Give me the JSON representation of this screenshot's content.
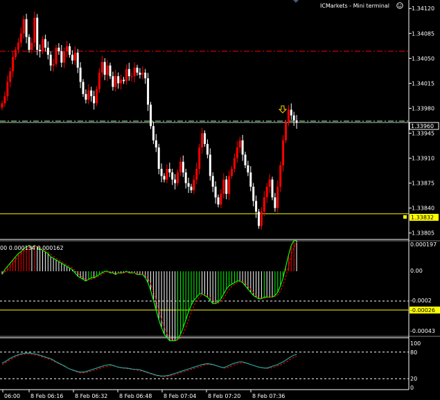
{
  "window": {
    "title": "ICMarkets - Mini terminal",
    "title_icon": "smiley-icon"
  },
  "colors": {
    "background": "#000000",
    "axis": "#ffffff",
    "bull_candle": "#ff0000",
    "bear_candle": "#ffffff",
    "level_line": "#ffff00",
    "resistance_line": "#ff0000",
    "bid_line": "#98fb98",
    "macd_up": "#ff0000",
    "macd_down": "#ffffff",
    "macd_green": "#00ff00",
    "stoch_main": "#20b2aa",
    "stoch_signal": "#ff0000",
    "arrow": "#ffd700"
  },
  "price_panel": {
    "axis_labels": [
      "1.34120",
      "1.34085",
      "1.34050",
      "1.34015",
      "1.33980",
      "1.33945",
      "1.33910",
      "1.33875",
      "1.33840",
      "1.33805"
    ],
    "current_price_label": "1.33960",
    "level_label": "1.33832",
    "arrow_icon": "down-arrow-icon"
  },
  "macd_panel": {
    "header": "00 0.000134 0.000162",
    "axis_labels": [
      "0.000197",
      "0.00",
      "-0.0002",
      "-0.00043"
    ],
    "level_label": "-0.00026"
  },
  "stoch_panel": {
    "axis_labels": [
      "100",
      "80",
      "20",
      "0"
    ]
  },
  "time_axis": {
    "labels": [
      "06:00",
      "8 Feb 06:16",
      "8 Feb 06:32",
      "8 Feb 06:48",
      "8 Feb 07:04",
      "8 Feb 07:20",
      "8 Feb 07:36"
    ]
  },
  "chart_data": {
    "type": "candlestick",
    "symbol": "",
    "price_range": [
      1.33796,
      1.34128
    ],
    "current_price": 1.3396,
    "horizontal_levels": {
      "resistance": 1.3406,
      "bid": 1.33962,
      "support": 1.33832
    },
    "closes": [
      1.33987,
      1.33997,
      1.34017,
      1.34032,
      1.34052,
      1.34062,
      1.34072,
      1.34085,
      1.34105,
      1.3408,
      1.34062,
      1.34072,
      1.34107,
      1.34062,
      1.3406,
      1.34077,
      1.34065,
      1.34055,
      1.3404,
      1.34042,
      1.34065,
      1.3406,
      1.34044,
      1.3406,
      1.34067,
      1.34055,
      1.34047,
      1.34058,
      1.34037,
      1.34017,
      1.34,
      1.33992,
      1.34005,
      1.33997,
      1.33987,
      1.34007,
      1.3403,
      1.34045,
      1.34027,
      1.3404,
      1.34025,
      1.3401,
      1.34025,
      1.34015,
      1.3402,
      1.34018,
      1.34035,
      1.34025,
      1.34025,
      1.34037,
      1.3403,
      1.34027,
      1.3403,
      1.34022,
      1.33985,
      1.33955,
      1.33935,
      1.33925,
      1.33895,
      1.33885,
      1.3388,
      1.33895,
      1.3389,
      1.3388,
      1.33875,
      1.3389,
      1.33905,
      1.3389,
      1.33875,
      1.3387,
      1.33865,
      1.3388,
      1.33895,
      1.33925,
      1.33945,
      1.3393,
      1.33915,
      1.33885,
      1.3387,
      1.33855,
      1.33845,
      1.3386,
      1.3388,
      1.3386,
      1.33885,
      1.33895,
      1.3391,
      1.33925,
      1.33935,
      1.33915,
      1.339,
      1.3389,
      1.3387,
      1.3385,
      1.33835,
      1.33815,
      1.33835,
      1.33855,
      1.3387,
      1.3388,
      1.33855,
      1.3384,
      1.3387,
      1.339,
      1.33935,
      1.3396,
      1.33978,
      1.3397,
      1.33963,
      1.3396
    ],
    "macd": {
      "histogram": [
        -2e-05,
        1e-05,
        3e-05,
        5e-05,
        7e-05,
        9e-05,
        0.00011,
        0.00012,
        0.00014,
        0.00015,
        0.00016,
        0.00015,
        0.00016,
        0.00015,
        0.00014,
        0.00013,
        0.00012,
        0.00011,
        9e-05,
        8e-05,
        7e-05,
        6e-05,
        5e-05,
        4e-05,
        3e-05,
        2e-05,
        1e-05,
        -1e-05,
        -3e-05,
        -4e-05,
        -5e-05,
        -6e-05,
        -5e-05,
        -4e-05,
        -4e-05,
        -3e-05,
        -2e-05,
        -1e-05,
        0.0,
        0.0,
        -1e-05,
        -1e-05,
        -2e-05,
        -1e-05,
        -1e-05,
        -1e-05,
        0.0,
        -1e-05,
        -1e-05,
        -1e-05,
        -2e-05,
        -2e-05,
        -2e-05,
        -4e-05,
        -7e-05,
        -0.00012,
        -0.00018,
        -0.00024,
        -0.0003,
        -0.00035,
        -0.00039,
        -0.00041,
        -0.00043,
        -0.00043,
        -0.00043,
        -0.00042,
        -0.00039,
        -0.00035,
        -0.0003,
        -0.00025,
        -0.00021,
        -0.00018,
        -0.00016,
        -0.00014,
        -0.00014,
        -0.00015,
        -0.00016,
        -0.00018,
        -0.0002,
        -0.0002,
        -0.00019,
        -0.00017,
        -0.00014,
        -0.00011,
        -9e-05,
        -8e-05,
        -7e-05,
        -6e-05,
        -6e-05,
        -7e-05,
        -9e-05,
        -0.00011,
        -0.00013,
        -0.00015,
        -0.00016,
        -0.00017,
        -0.00017,
        -0.00016,
        -0.00016,
        -0.00016,
        -0.00016,
        -0.00015,
        -0.00013,
        -9e-05,
        -4e-05,
        3e-05,
        0.0001,
        0.00016,
        0.00019,
        0.00019
      ],
      "signal_color": "#00ff00"
    },
    "stochastic": {
      "main": [
        55,
        58,
        62,
        66,
        69,
        72,
        74,
        76,
        77,
        78,
        78,
        77,
        76,
        75,
        73,
        71,
        69,
        67,
        65,
        62,
        58,
        55,
        52,
        49,
        45,
        42,
        40,
        38,
        36,
        35,
        35,
        36,
        38,
        40,
        42,
        44,
        46,
        48,
        50,
        51,
        52,
        50,
        48,
        46,
        45,
        44,
        44,
        43,
        42,
        41,
        41,
        40,
        38,
        36,
        34,
        32,
        30,
        28,
        27,
        26,
        26,
        27,
        28,
        30,
        32,
        34,
        36,
        38,
        40,
        42,
        44,
        46,
        48,
        50,
        52,
        53,
        54,
        53,
        52,
        50,
        48,
        46,
        45,
        47,
        50,
        53,
        55,
        57,
        58,
        58,
        56,
        54,
        52,
        50,
        48,
        46,
        45,
        44,
        44,
        46,
        48,
        50,
        52,
        55,
        58,
        62,
        66,
        70,
        73,
        75
      ],
      "signal": [
        52,
        55,
        59,
        63,
        66,
        69,
        72,
        74,
        75,
        76,
        76,
        75,
        74,
        73,
        71,
        69,
        67,
        65,
        63,
        60,
        57,
        54,
        51,
        48,
        45,
        42,
        39,
        37,
        35,
        33,
        33,
        34,
        35,
        37,
        39,
        41,
        43,
        45,
        47,
        48,
        49,
        49,
        48,
        46,
        45,
        44,
        43,
        42,
        41,
        40,
        39,
        38,
        37,
        35,
        33,
        31,
        29,
        27,
        26,
        25,
        25,
        25,
        26,
        27,
        29,
        31,
        33,
        35,
        37,
        39,
        41,
        43,
        45,
        47,
        49,
        51,
        52,
        52,
        51,
        50,
        48,
        46,
        44,
        44,
        46,
        49,
        51,
        53,
        55,
        56,
        55,
        54,
        52,
        50,
        48,
        46,
        45,
        44,
        43,
        44,
        45,
        47,
        49,
        51,
        54,
        57,
        61,
        65,
        68,
        71
      ],
      "levels": [
        80,
        20
      ],
      "range": [
        0,
        100
      ]
    }
  }
}
